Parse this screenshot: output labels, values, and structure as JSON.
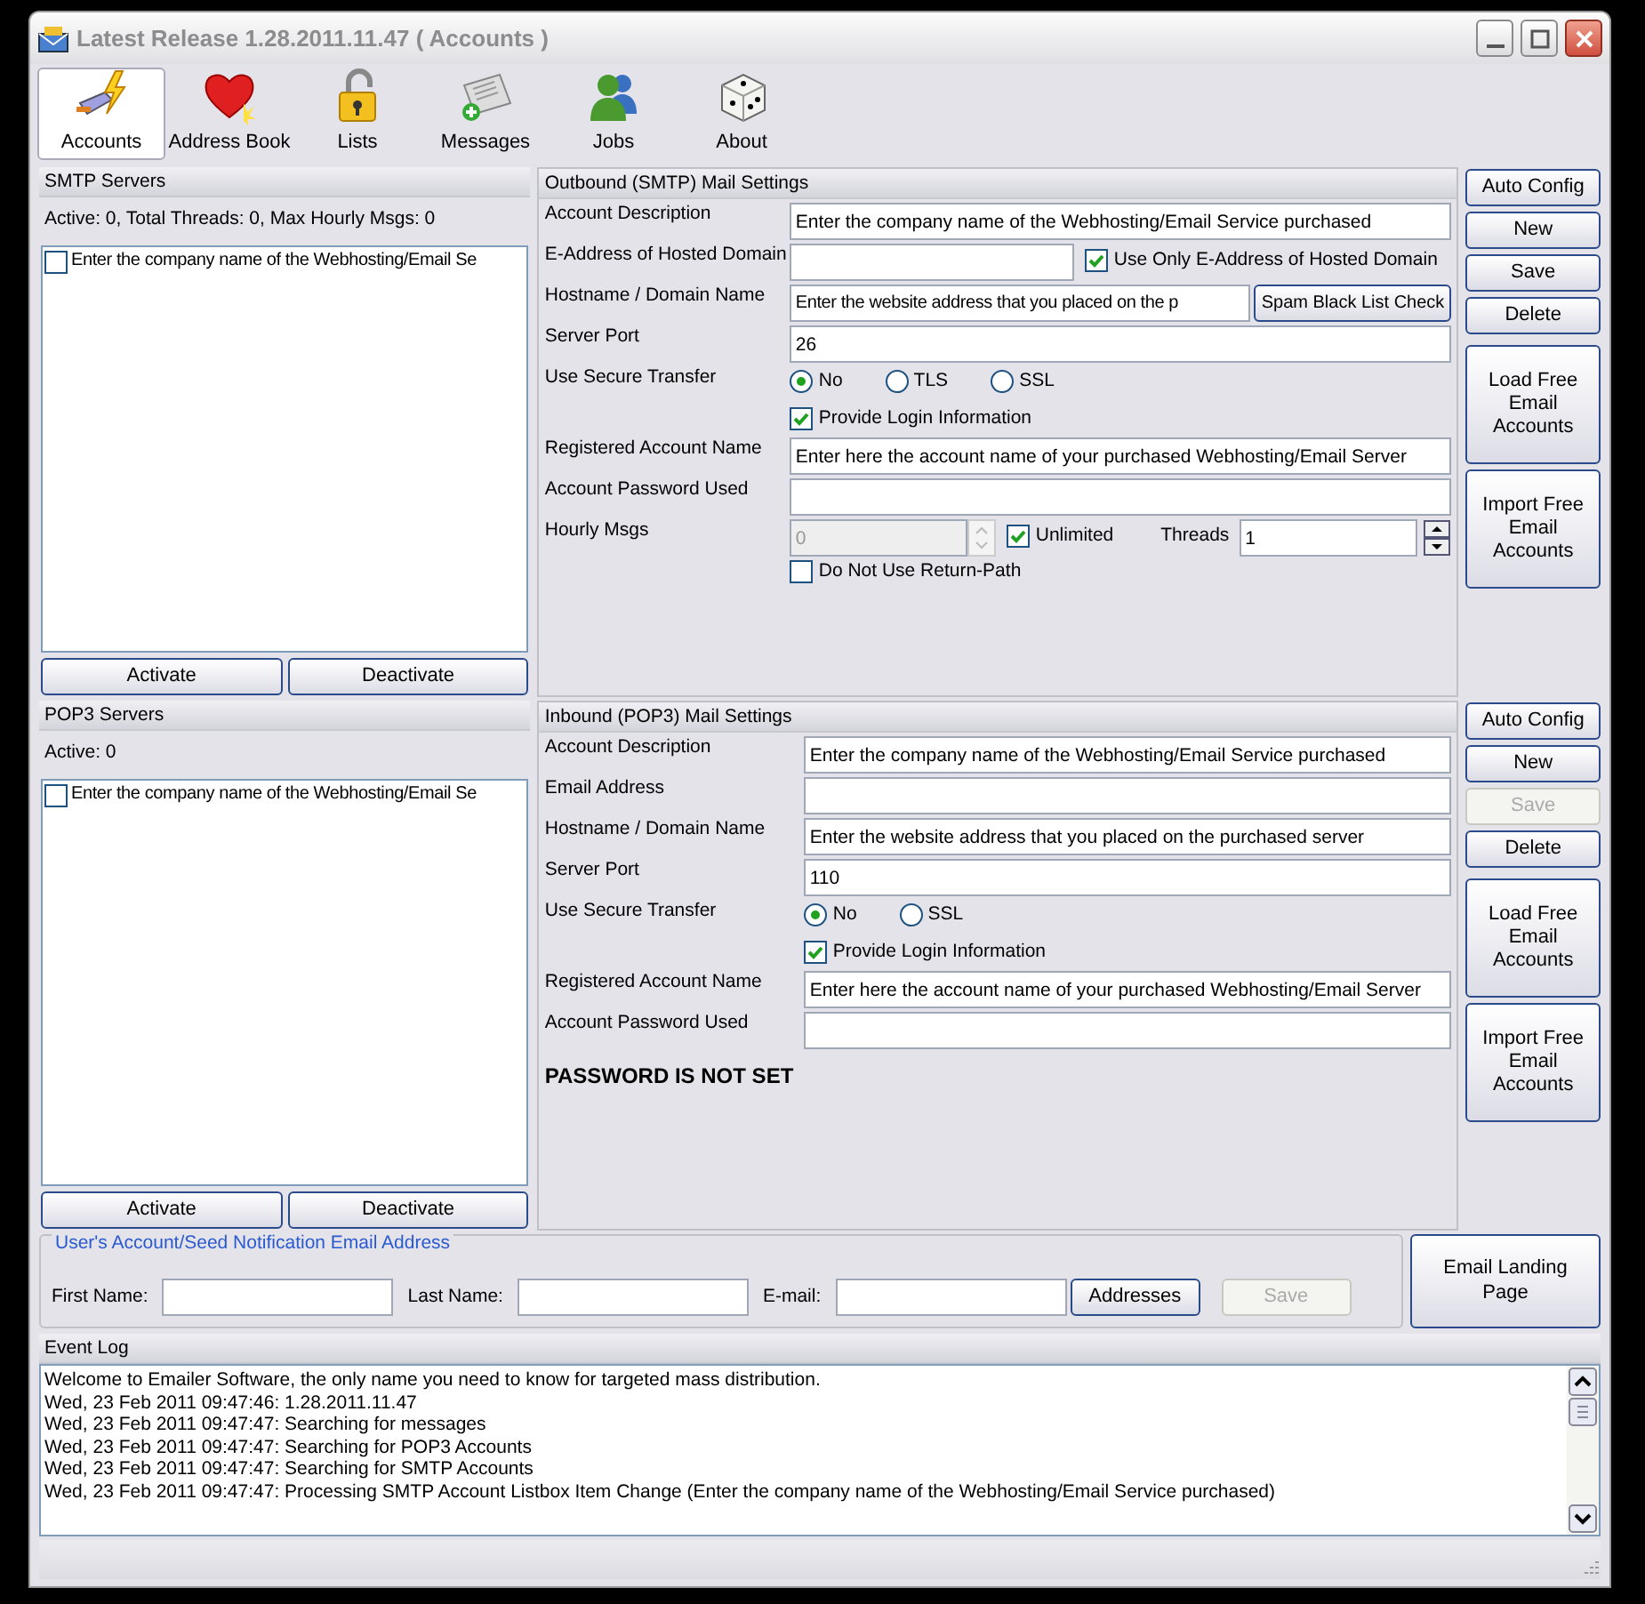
{
  "window": {
    "title": "Latest Release 1.28.2011.11.47 ( Accounts )"
  },
  "toolbar": [
    {
      "label": "Accounts",
      "selected": true,
      "kind": "plug"
    },
    {
      "label": "Address Book",
      "selected": false,
      "kind": "heart"
    },
    {
      "label": "Lists",
      "selected": false,
      "kind": "lock"
    },
    {
      "label": "Messages",
      "selected": false,
      "kind": "paper"
    },
    {
      "label": "Jobs",
      "selected": false,
      "kind": "people"
    },
    {
      "label": "About",
      "selected": false,
      "kind": "dice"
    }
  ],
  "sections": [
    {
      "servers": {
        "title": "SMTP Servers",
        "summary": "Active: 0, Total Threads: 0, Max Hourly Msgs: 0",
        "items": [
          {
            "label": "Enter the company name of the Webhosting/Email Se",
            "checked": false
          }
        ],
        "buttons": [
          "Activate",
          "Deactivate"
        ]
      },
      "settings": {
        "title": "Outbound (SMTP) Mail Settings",
        "rows": [
          {
            "kind": "text",
            "label": "Account Description",
            "value": "Enter the company name of the Webhosting/Email Service purchased"
          },
          {
            "kind": "text_check",
            "label": "E-Address of Hosted Domain",
            "check": {
              "label": "Use Only E-Address of Hosted Domain",
              "checked": true
            }
          },
          {
            "kind": "text_button",
            "label": "Hostname / Domain Name",
            "value": "Enter the website address that you placed on the p",
            "button": "Spam Black List Check"
          },
          {
            "kind": "text",
            "label": "Server Port",
            "value": "26"
          },
          {
            "kind": "radio",
            "label": "Use Secure Transfer",
            "options": [
              {
                "label": "No",
                "selected": true
              },
              {
                "label": "TLS",
                "selected": false
              },
              {
                "label": "SSL",
                "selected": false
              }
            ]
          },
          {
            "kind": "check",
            "check": {
              "label": "Provide Login Information",
              "checked": true
            }
          },
          {
            "kind": "text",
            "label": "Registered Account Name",
            "value": "Enter here the account name of your purchased Webhosting/Email Server"
          },
          {
            "kind": "text",
            "label": "Account Password Used"
          },
          {
            "kind": "hourly",
            "label": "Hourly Msgs",
            "value": "0",
            "disabled": true,
            "check": {
              "label": "Unlimited",
              "checked": true
            },
            "threads_label": "Threads",
            "threads_value": "1"
          },
          {
            "kind": "check",
            "check": {
              "label": "Do Not Use Return-Path",
              "checked": false
            }
          }
        ]
      },
      "buttons": [
        {
          "label": "Auto Config",
          "disabled": false
        },
        {
          "label": "New",
          "disabled": false
        },
        {
          "label": "Save",
          "disabled": false
        },
        {
          "label": "Delete",
          "disabled": false
        },
        {
          "label": "Load Free Email Accounts",
          "disabled": false
        },
        {
          "label": "Import Free Email Accounts",
          "disabled": false
        }
      ]
    },
    {
      "servers": {
        "title": "POP3 Servers",
        "summary": "Active: 0",
        "items": [
          {
            "label": "Enter the company name of the Webhosting/Email Se",
            "checked": false
          }
        ],
        "buttons": [
          "Activate",
          "Deactivate"
        ]
      },
      "settings": {
        "title": "Inbound (POP3) Mail Settings",
        "rows": [
          {
            "kind": "text",
            "label": "Account Description",
            "value": "Enter the company name of the Webhosting/Email Service purchased"
          },
          {
            "kind": "text",
            "label": "Email Address"
          },
          {
            "kind": "text",
            "label": "Hostname / Domain Name",
            "value": "Enter the website address that you placed on the purchased server"
          },
          {
            "kind": "text",
            "label": "Server Port",
            "value": "110"
          },
          {
            "kind": "radio",
            "label": "Use Secure Transfer",
            "options": [
              {
                "label": "No",
                "selected": true
              },
              {
                "label": "SSL",
                "selected": false
              }
            ]
          },
          {
            "kind": "check",
            "check": {
              "label": "Provide Login Information",
              "checked": true
            }
          },
          {
            "kind": "text",
            "label": "Registered Account Name",
            "value": "Enter here the account name of your purchased Webhosting/Email Server"
          },
          {
            "kind": "text",
            "label": "Account Password Used"
          },
          {
            "kind": "notice",
            "label": "PASSWORD IS NOT SET"
          }
        ]
      },
      "buttons": [
        {
          "label": "Auto Config",
          "disabled": false
        },
        {
          "label": "New",
          "disabled": false
        },
        {
          "label": "Save",
          "disabled": true
        },
        {
          "label": "Delete",
          "disabled": false
        },
        {
          "label": "Load Free Email Accounts",
          "disabled": false
        },
        {
          "label": "Import Free Email Accounts",
          "disabled": false
        }
      ]
    }
  ],
  "seed": {
    "title": "User's Account/Seed Notification Email Address",
    "fields": [
      {
        "label": "First Name:"
      },
      {
        "label": "Last Name:"
      },
      {
        "label": "E-mail:"
      }
    ],
    "buttons": [
      {
        "label": "Addresses",
        "disabled": false
      },
      {
        "label": "Save",
        "disabled": true
      }
    ]
  },
  "landing_button": "Email Landing Page",
  "event_log": {
    "title": "Event Log",
    "lines": [
      "Welcome to Emailer Software, the only name you need to know for targeted mass distribution.",
      "Wed, 23 Feb 2011 09:47:46: 1.28.2011.11.47",
      "Wed, 23 Feb 2011 09:47:47: Searching for messages",
      "Wed, 23 Feb 2011 09:47:47: Searching for POP3 Accounts",
      "Wed, 23 Feb 2011 09:47:47: Searching for SMTP Accounts",
      "Wed, 23 Feb 2011 09:47:47: Processing SMTP Account Listbox Item Change (Enter the company name of the Webhosting/Email Service purchased)"
    ]
  }
}
